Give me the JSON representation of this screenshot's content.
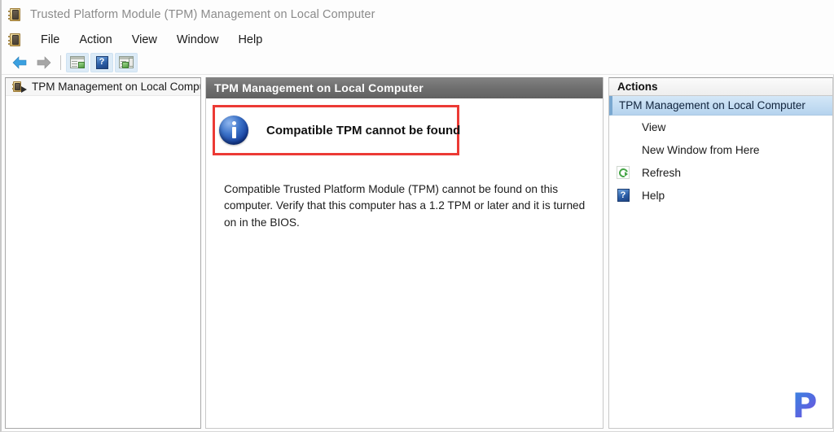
{
  "window": {
    "title": "Trusted Platform Module (TPM) Management on Local Computer",
    "icon": "tpm-chip-icon"
  },
  "menubar": {
    "items": [
      {
        "label": "File"
      },
      {
        "label": "Action"
      },
      {
        "label": "View"
      },
      {
        "label": "Window"
      },
      {
        "label": "Help"
      }
    ]
  },
  "toolbar": {
    "buttons": [
      {
        "name": "back-button",
        "icon": "back-arrow-icon",
        "state": "enabled"
      },
      {
        "name": "forward-button",
        "icon": "forward-arrow-icon",
        "state": "disabled"
      },
      {
        "name": "show-console-tree-button",
        "icon": "console-tree-icon"
      },
      {
        "name": "help-button",
        "icon": "help-icon"
      },
      {
        "name": "export-list-button",
        "icon": "export-list-icon"
      }
    ]
  },
  "tree": {
    "items": [
      {
        "label": "TPM Management on Local Compu",
        "icon": "tpm-node-icon",
        "selected": true
      }
    ]
  },
  "content": {
    "header": "TPM Management on Local Computer",
    "message": {
      "icon": "info-icon",
      "title": "Compatible TPM cannot be found",
      "body": "Compatible Trusted Platform Module (TPM) cannot be found on this computer. Verify that this computer has a 1.2 TPM or later and it is turned on in the BIOS.",
      "highlight_color": "#ec3a35"
    }
  },
  "actions": {
    "header": "Actions",
    "section_title": "TPM Management on Local Computer",
    "items": [
      {
        "label": "View",
        "icon": "",
        "indent": true
      },
      {
        "label": "New Window from Here",
        "icon": "",
        "indent": true
      },
      {
        "label": "Refresh",
        "icon": "refresh-icon",
        "indent": false
      },
      {
        "label": "Help",
        "icon": "help-icon",
        "indent": false
      }
    ]
  },
  "watermark": {
    "letter": "P"
  }
}
